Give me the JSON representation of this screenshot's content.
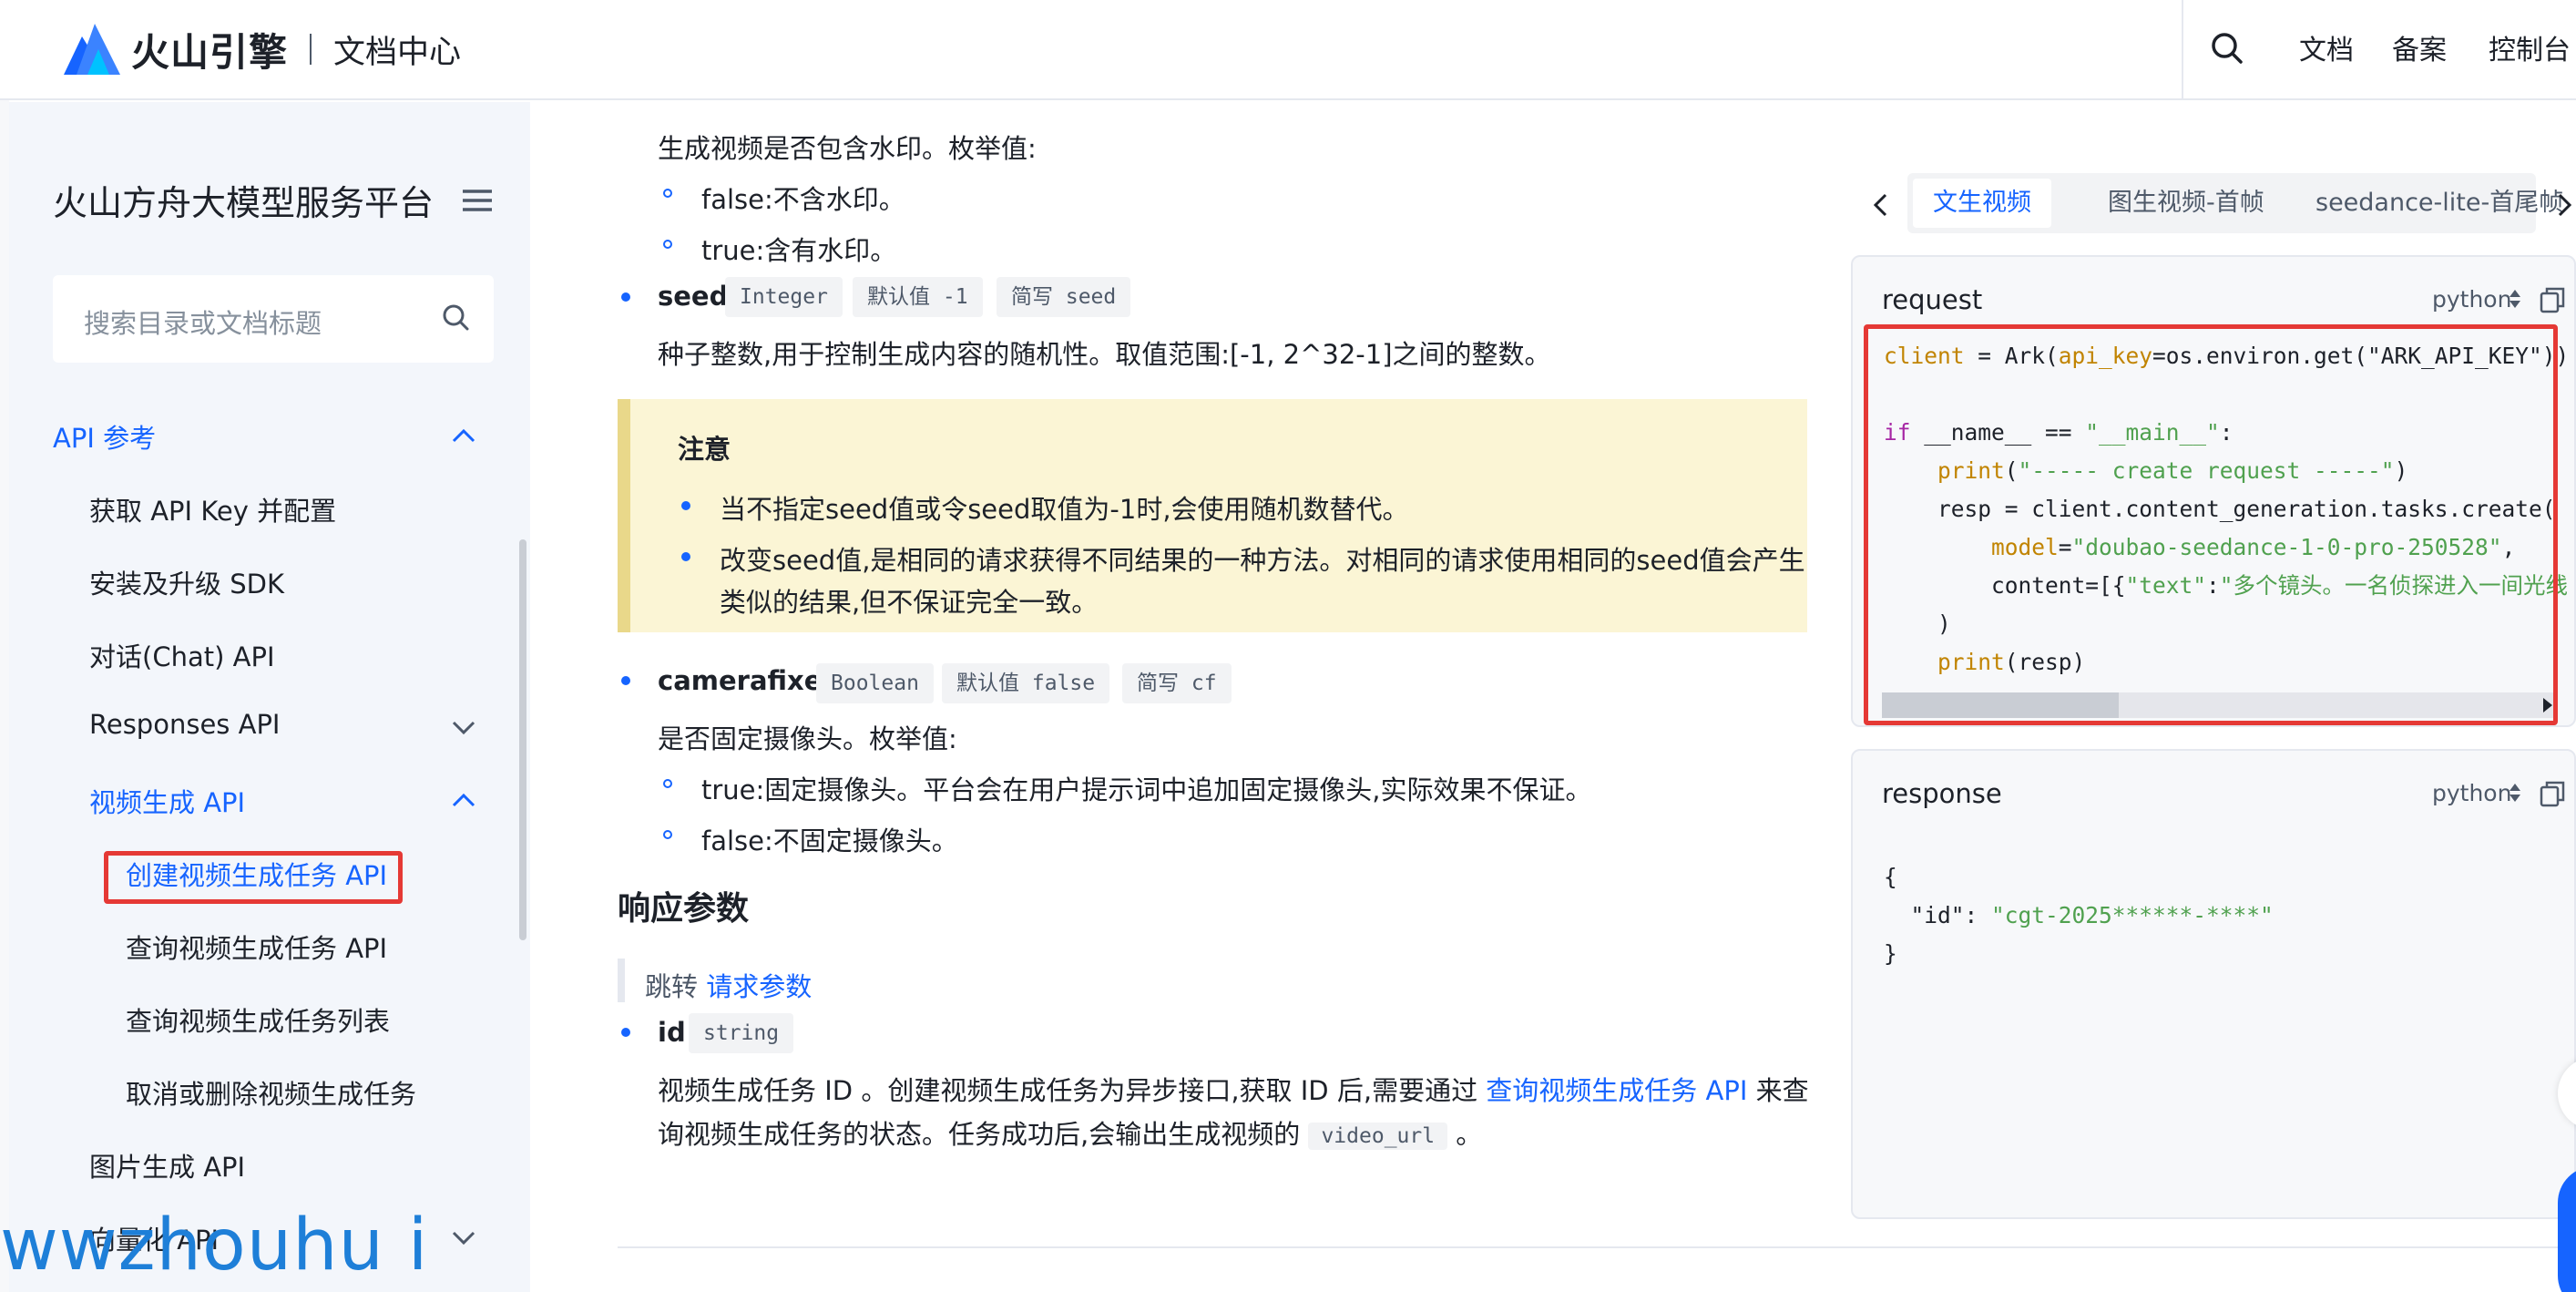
{
  "header": {
    "brand": "火山引擎",
    "subtitle": "文档中心",
    "nav": [
      "文档",
      "备案",
      "控制台"
    ]
  },
  "sidebar": {
    "title": "火山方舟大模型服务平台",
    "search_placeholder": "搜索目录或文档标题",
    "items": [
      {
        "label": "API 参考",
        "active": true
      },
      {
        "label": "获取 API Key 并配置"
      },
      {
        "label": "安装及升级 SDK"
      },
      {
        "label": "对话(Chat) API"
      },
      {
        "label": "Responses API"
      },
      {
        "label": "视频生成 API",
        "active": true
      },
      {
        "label": "创建视频生成任务 API",
        "active": true,
        "highlighted": true
      },
      {
        "label": "查询视频生成任务 API"
      },
      {
        "label": "查询视频生成任务列表"
      },
      {
        "label": "取消或删除视频生成任务"
      },
      {
        "label": "图片生成 API"
      },
      {
        "label": "向量化 API"
      }
    ]
  },
  "content": {
    "watermark_desc": "生成视频是否包含水印。枚举值:",
    "watermark_false": "false:不含水印。",
    "watermark_true": "true:含有水印。",
    "seed": {
      "name": "seed",
      "type": "Integer",
      "default": "默认值 -1",
      "alias": "简写 seed",
      "desc": "种子整数,用于控制生成内容的随机性。取值范围:[-1, 2^32-1]之间的整数。"
    },
    "note": {
      "title": "注意",
      "items": [
        "当不指定seed值或令seed取值为-1时,会使用随机数替代。",
        "改变seed值,是相同的请求获得不同结果的一种方法。对相同的请求使用相同的seed值会产生",
        "类似的结果,但不保证完全一致。"
      ]
    },
    "camerafixed": {
      "name": "camerafixed",
      "type": "Boolean",
      "default": "默认值 false",
      "alias": "简写 cf",
      "desc": "是否固定摄像头。枚举值:",
      "opt_true": "true:固定摄像头。平台会在用户提示词中追加固定摄像头,实际效果不保证。",
      "opt_false": "false:不固定摄像头。"
    },
    "response_heading": "响应参数",
    "jump_prefix": "跳转",
    "jump_link": "请求参数",
    "id_param": {
      "name": "id",
      "type": "string",
      "desc_1_prefix": "视频生成任务 ID 。创建视频生成任务为异步接口,获取 ID 后,需要通过",
      "desc_1_link": "查询视频生成任务 API",
      "desc_1_suffix": "来查",
      "desc_2_prefix": "询视频生成任务的状态。任务成功后,会输出生成视频的",
      "desc_2_code": "video_url",
      "desc_2_suffix": "。"
    }
  },
  "code_panel": {
    "tabs": [
      "文生视频",
      "图生视频-首帧",
      "seedance-lite-首尾帧"
    ],
    "request": {
      "label": "request",
      "lang": "python"
    },
    "response": {
      "label": "response",
      "lang": "python"
    }
  },
  "watermark": "wwzhouhu i"
}
